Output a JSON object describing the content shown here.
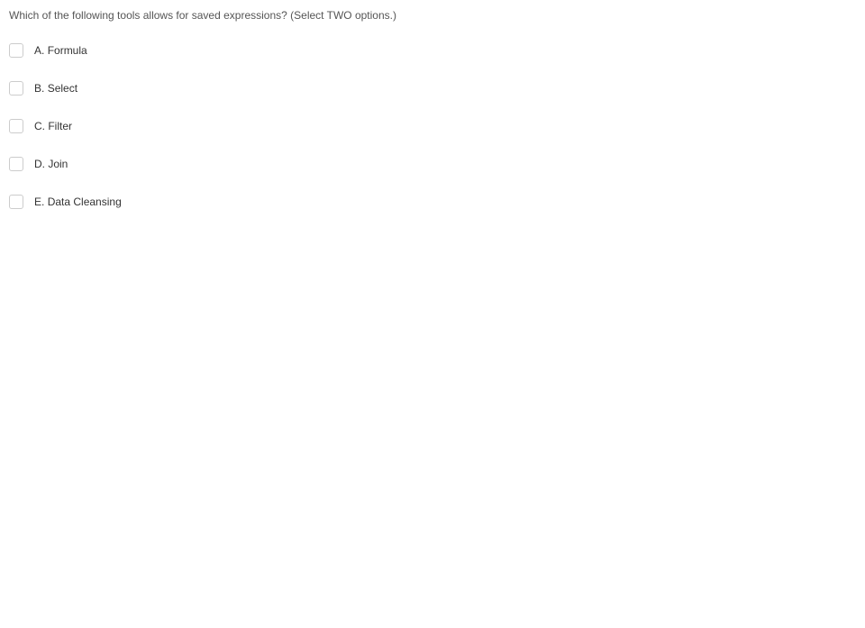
{
  "question": {
    "text": "Which of the following tools allows for saved expressions? (Select TWO options.)"
  },
  "options": [
    {
      "letter": "A",
      "label": "Formula"
    },
    {
      "letter": "B",
      "label": "Select"
    },
    {
      "letter": "C",
      "label": "Filter"
    },
    {
      "letter": "D",
      "label": "Join"
    },
    {
      "letter": "E",
      "label": "Data Cleansing"
    }
  ]
}
